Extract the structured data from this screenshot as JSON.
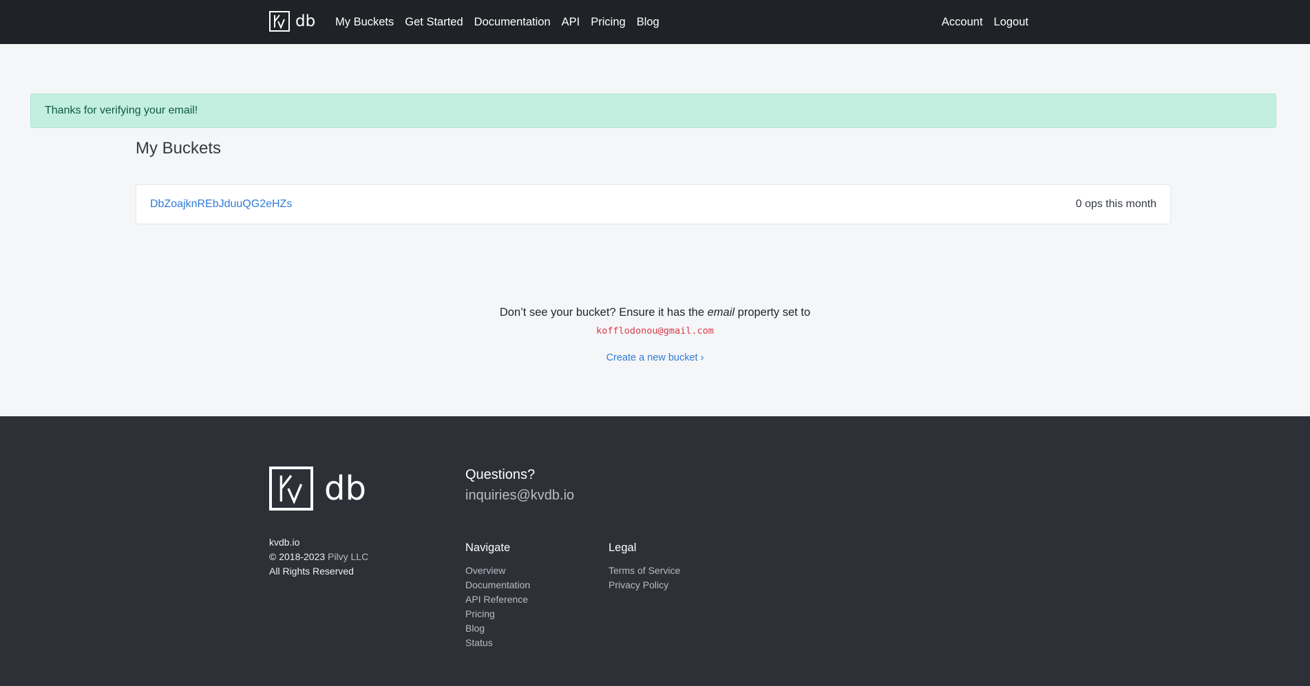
{
  "nav": {
    "logo_text": "db",
    "links": [
      "My Buckets",
      "Get Started",
      "Documentation",
      "API",
      "Pricing",
      "Blog"
    ],
    "right_links": [
      "Account",
      "Logout"
    ]
  },
  "alert": {
    "message": "Thanks for verifying your email!"
  },
  "page": {
    "title": "My Buckets",
    "bucket": {
      "name": "DbZoajknREbJduuQG2eHZs",
      "ops": "0 ops this month"
    },
    "hint_prefix": "Don’t see your bucket? Ensure it has the ",
    "hint_em": "email",
    "hint_suffix": " property set to",
    "hint_email": "kofflodonou@gmail.com",
    "create_link": "Create a new bucket ›"
  },
  "footer": {
    "logo_text": "db",
    "site": "kvdb.io",
    "copyright_prefix": "© 2018-2023 ",
    "company": "Pilvy LLC",
    "rights": "All Rights Reserved",
    "questions_title": "Questions?",
    "questions_email": "inquiries@kvdb.io",
    "navigate": {
      "title": "Navigate",
      "items": [
        "Overview",
        "Documentation",
        "API Reference",
        "Pricing",
        "Blog",
        "Status"
      ]
    },
    "legal": {
      "title": "Legal",
      "items": [
        "Terms of Service",
        "Privacy Policy"
      ]
    }
  },
  "colors": {
    "navbar": "#1f2226",
    "alert_bg": "#c3efe0",
    "link": "#2f7bd6",
    "footer_bg": "#2d3036",
    "code": "#d63a4a"
  },
  "icons": {
    "logo": "kv-logo-icon"
  }
}
